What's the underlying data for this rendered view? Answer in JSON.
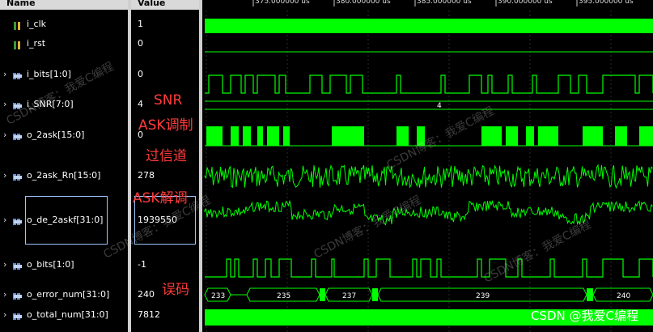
{
  "name_header": "Name",
  "value_header": "Value",
  "signals": [
    {
      "name": "i_clk",
      "value": "1",
      "icon": "bit-icon",
      "expandable": false
    },
    {
      "name": "i_rst",
      "value": "0",
      "icon": "bit-icon",
      "expandable": false
    },
    {
      "name": "i_bits[1:0]",
      "value": "0",
      "icon": "bus-icon",
      "expandable": true
    },
    {
      "name": "i_SNR[7:0]",
      "value": "4",
      "icon": "bus-icon",
      "expandable": true
    },
    {
      "name": "o_2ask[15:0]",
      "value": "0",
      "icon": "bus-icon",
      "expandable": true
    },
    {
      "name": "o_2ask_Rn[15:0]",
      "value": "278",
      "icon": "bus-icon",
      "expandable": true
    },
    {
      "name": "o_de_2askf[31:0]",
      "value": "1939550",
      "icon": "bus-icon",
      "expandable": true
    },
    {
      "name": "o_bits[1:0]",
      "value": "-1",
      "icon": "bus-icon",
      "expandable": true
    },
    {
      "name": "o_error_num[31:0]",
      "value": "240",
      "icon": "bus-icon",
      "expandable": true
    },
    {
      "name": "o_total_num[31:0]",
      "value": "7812",
      "icon": "bus-icon",
      "expandable": true
    }
  ],
  "time_ruler": [
    "375.000000 us",
    "380.000000 us",
    "385.000000 us",
    "390.000000 us",
    "395.000000 us"
  ],
  "snr_bus_value": "4",
  "error_bus_values": [
    "233",
    "235",
    "237",
    "239",
    "240"
  ],
  "annotations": [
    "SNR",
    "ASK调制",
    "过信道",
    "ASK解调",
    "误码"
  ],
  "watermarks": [
    "CSDN博客：我爱C编程",
    "CSDN博客：我爱C编程",
    "CSDN博客：我爱C编程",
    "CSDN博客：我爱C编程",
    "CSDN博客：我爱C编程"
  ],
  "footer_watermark": "CSDN @我爱C编程",
  "colors": {
    "waveform": "#00ff00",
    "annotation": "#ff3b3b",
    "background": "#000000",
    "selection": "#9cc3ff"
  }
}
